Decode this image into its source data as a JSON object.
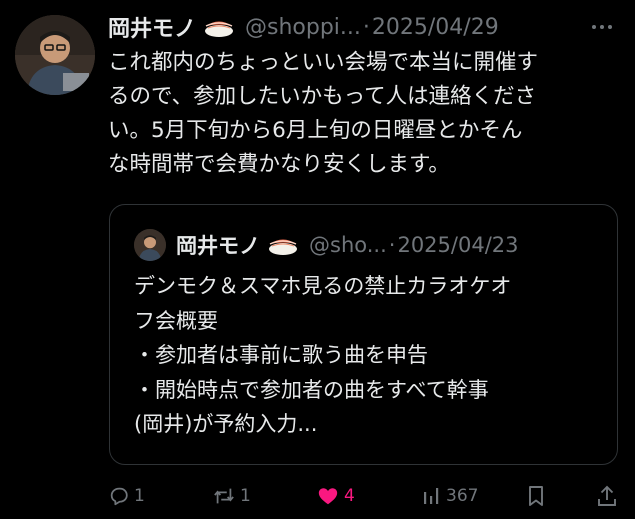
{
  "tweet": {
    "author_name": "岡井モノ",
    "handle": "@shoppi...",
    "separator": "·",
    "date": "2025/04/29",
    "text_lines": [
      "これ都内のちょっといい会場で本当に開催す",
      "るので、参加したいかもって人は連絡くださ",
      "い。5月下旬から6月上旬の日曜昼とかそん",
      "な時間帯で会費かなり安くします。"
    ]
  },
  "quote": {
    "author_name": "岡井モノ",
    "handle": "@sho...",
    "separator": "·",
    "date": "2025/04/23",
    "text_lines": [
      "デンモク＆スマホ見るの禁止カラオケオ",
      "フ会概要",
      "・参加者は事前に歌う曲を申告",
      "・開始時点で参加者の曲をすべて幹事",
      "(岡井)が予約入力..."
    ]
  },
  "actions": {
    "reply_count": "1",
    "repost_count": "1",
    "like_count": "4",
    "view_count": "367"
  },
  "colors": {
    "background": "#000000",
    "text": "#e7e9ea",
    "muted": "#71767b",
    "like": "#f91880",
    "border": "#2f3336"
  },
  "icons": [
    "sushi-emoji-icon",
    "more-icon",
    "reply-icon",
    "repost-icon",
    "like-icon",
    "views-icon",
    "bookmark-icon",
    "share-icon"
  ]
}
